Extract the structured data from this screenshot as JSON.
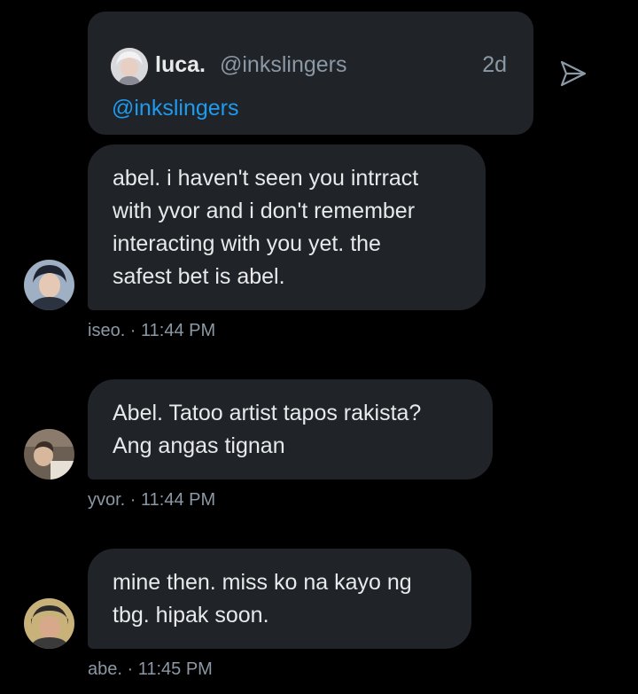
{
  "quoted_tweet": {
    "name": "luca.",
    "handle": "@inkslingers",
    "time": "2d",
    "mention": "@inkslingers"
  },
  "messages": [
    {
      "lines": [
        "abel. i haven't seen you intrract",
        "with yvor and i don't remember",
        "interacting with you yet. the",
        "safest bet is abel."
      ],
      "meta": "iseo. · 11:44 PM"
    },
    {
      "lines": [
        "Abel. Tatoo artist tapos rakista?",
        "Ang angas tignan"
      ],
      "meta": "yvor. · 11:44 PM"
    },
    {
      "lines": [
        "mine then. miss ko na kayo ng",
        "tbg. hipak soon."
      ],
      "meta": "abe. · 11:45 PM"
    }
  ],
  "colors": {
    "background": "#000000",
    "bubble": "#202327",
    "text": "#e7e9ea",
    "muted": "#8b98a5",
    "link": "#1d9bf0"
  },
  "icons": {
    "share": "send-icon",
    "avatar": "avatar"
  }
}
